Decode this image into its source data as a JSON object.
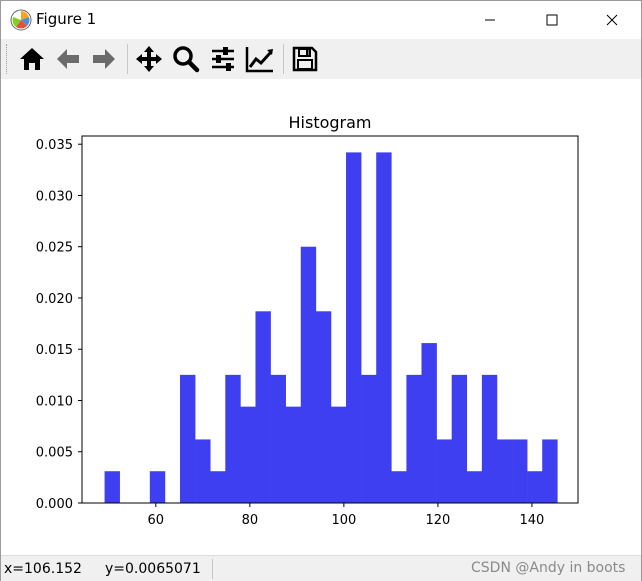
{
  "window": {
    "title": "Figure 1"
  },
  "toolbar": {
    "buttons": [
      "home-icon",
      "back-arrow-icon",
      "forward-arrow-icon",
      "pan-icon",
      "zoom-icon",
      "subplots-config-icon",
      "edit-axis-icon",
      "save-icon"
    ]
  },
  "status": {
    "x": "x=106.152",
    "y": "y=0.0065071",
    "watermark": "CSDN @Andy in boots"
  },
  "colors": {
    "bar": "#3f3ff2",
    "toolbar_bg": "#f0f0f0"
  },
  "chart_data": {
    "type": "bar",
    "title": "Histogram",
    "xlabel": "",
    "ylabel": "",
    "xlim": [
      44.3,
      149.8
    ],
    "ylim": [
      0,
      0.0358
    ],
    "xticks": [
      60,
      80,
      100,
      120,
      140
    ],
    "yticks": [
      "0.000",
      "0.005",
      "0.010",
      "0.015",
      "0.020",
      "0.025",
      "0.030",
      "0.035"
    ],
    "bin_start": 49.1,
    "bin_width": 3.21,
    "values": [
      0.0031,
      0,
      0,
      0.0031,
      0,
      0.0125,
      0.0062,
      0.0031,
      0.0125,
      0.0094,
      0.0187,
      0.0125,
      0.0094,
      0.025,
      0.0187,
      0.0094,
      0.0342,
      0.0125,
      0.0342,
      0.0031,
      0.0125,
      0.0156,
      0.0062,
      0.0125,
      0.0031,
      0.0125,
      0.0062,
      0.0062,
      0.0031,
      0.0062
    ]
  }
}
